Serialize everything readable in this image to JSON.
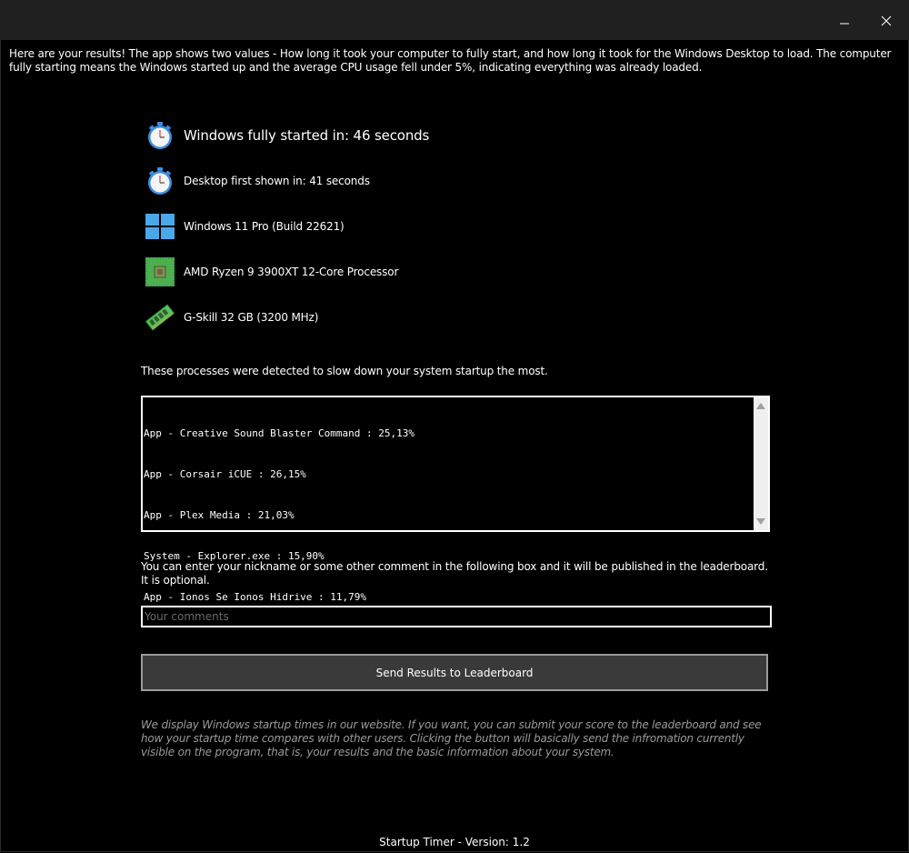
{
  "window": {
    "minimize_glyph": "—",
    "close_glyph": "✕"
  },
  "intro_text": "Here are your results! The app shows two values - How long it took your computer to fully start, and how long it took for the Windows Desktop to load. The computer fully starting means the Windows started up and the average CPU usage fell under 5%, indicating everything was already loaded.",
  "results": {
    "fully_started": "Windows fully started in: 46 seconds",
    "desktop_shown": "Desktop first shown in: 41 seconds"
  },
  "system": {
    "os": "Windows 11 Pro (Build 22621)",
    "cpu": "AMD Ryzen 9 3900XT 12-Core Processor",
    "ram": "G-Skill 32 GB (3200 MHz)"
  },
  "icons": {
    "stopwatch": "stopwatch-icon",
    "windows": "windows-logo-icon",
    "cpu": "cpu-chip-icon",
    "ram": "ram-module-icon"
  },
  "processes": {
    "label": "These processes were detected to slow down your system startup the most.",
    "lines": [
      "App - Creative Sound Blaster Command : 25,13%",
      "App - Corsair iCUE : 26,15%",
      "App - Plex Media : 21,03%",
      "System - Explorer.exe : 15,90%",
      "App - Ionos Se Ionos Hidrive : 11,79%"
    ]
  },
  "comment": {
    "label": "You can enter your nickname or some other comment in the following box and it will be published in the leaderboard. It is optional.",
    "placeholder": "Your comments",
    "value": ""
  },
  "send_button": "Send Results to Leaderboard",
  "note": "We display Windows startup times in our website. If you want, you can submit your score to the leaderboard and see how your startup time compares with other users. Clicking the button will basically send the infromation currently visible on the program, that is, your results and the basic information about your system.",
  "footer": "Startup Timer - Version: 1.2",
  "colors": {
    "background": "#000000",
    "titlebar": "#202020",
    "button_bg": "#3a3a3a",
    "muted_text": "#9a9a9a"
  }
}
